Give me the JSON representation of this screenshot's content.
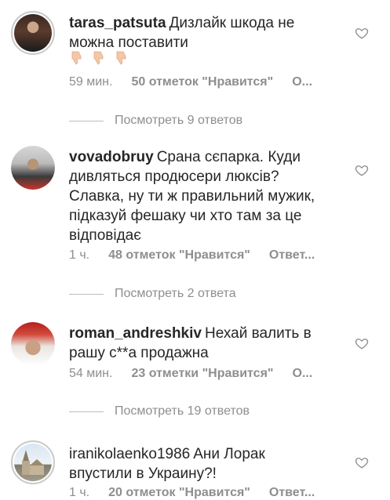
{
  "comments": [
    {
      "username": "taras_patsuta",
      "text": "Дизлайк шкода не можна поставити",
      "emoji_icons": [
        "thumbs-down-icon",
        "thumbs-down-icon",
        "thumbs-down-icon"
      ],
      "time": "59 мин.",
      "likes": "50 отметок \"Нравится\"",
      "reply": "О...",
      "view_replies": "Посмотреть 9 ответов"
    },
    {
      "username": "vovadobruy",
      "text": "Срана сєпарка. Куди дивляться продюсери люксів? Славка, ну ти ж правильний мужик, підказуй фешаку чи хто там за це відповідає",
      "time": "1 ч.",
      "likes": "48 отметок \"Нравится\"",
      "reply": "Ответ...",
      "view_replies": "Посмотреть 2 ответа"
    },
    {
      "username": "roman_andreshkiv",
      "text": "Нехай валить в рашу с**а продажна",
      "time": "54 мин.",
      "likes": "23 отметки \"Нравится\"",
      "reply": "О...",
      "view_replies": "Посмотреть 19 ответов"
    },
    {
      "username": "iranikolaenko1986",
      "text": "Ани Лорак впустили в Украину?!",
      "time": "1 ч.",
      "likes": "20 отметок \"Нравится\"",
      "reply": "Ответ..."
    }
  ],
  "colors": {
    "text": "#262626",
    "meta": "#8e8e8e",
    "divider": "#bdbdbd"
  }
}
